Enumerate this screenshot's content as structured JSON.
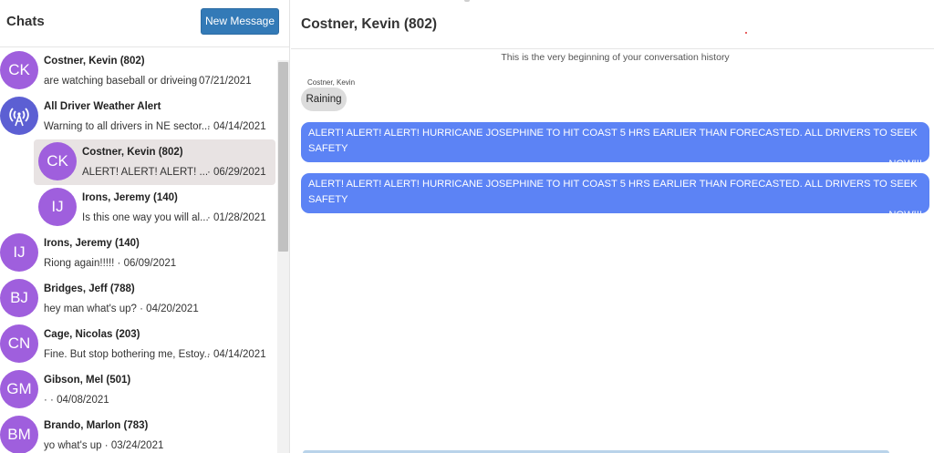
{
  "sidebar": {
    "title": "Chats",
    "new_message_label": "New Message",
    "chats": [
      {
        "initials": "CK",
        "name": "Costner, Kevin (802)",
        "preview": "are watching baseball or driveing",
        "date": "07/21/2021",
        "avatar_type": "initials"
      },
      {
        "initials": "",
        "name": "All Driver Weather Alert",
        "preview": "Warning to all drivers in NE sector...",
        "date": "04/14/2021",
        "avatar_type": "broadcast-icon"
      },
      {
        "initials": "CK",
        "name": "Costner, Kevin (802)",
        "preview": "ALERT! ALERT! ALERT! ...",
        "date": "06/29/2021",
        "avatar_type": "initials",
        "selected": true
      },
      {
        "initials": "IJ",
        "name": "Irons, Jeremy (140)",
        "preview": "Is this one way you will al...",
        "date": "01/28/2021",
        "avatar_type": "initials"
      },
      {
        "initials": "IJ",
        "name": "Irons, Jeremy (140)",
        "preview": "Riong again!!!!!",
        "date": "06/09/2021",
        "avatar_type": "initials"
      },
      {
        "initials": "BJ",
        "name": "Bridges, Jeff (788)",
        "preview": "hey man what's up?",
        "date": "04/20/2021",
        "avatar_type": "initials"
      },
      {
        "initials": "CN",
        "name": "Cage, Nicolas (203)",
        "preview": "Fine. But stop bothering me, Estoy...",
        "date": "04/14/2021",
        "avatar_type": "initials"
      },
      {
        "initials": "GM",
        "name": "Gibson, Mel (501)",
        "preview": "·",
        "date": "04/08/2021",
        "avatar_type": "initials"
      },
      {
        "initials": "BM",
        "name": "Brando, Marlon (783)",
        "preview": "yo what's up",
        "date": "03/24/2021",
        "avatar_type": "initials"
      }
    ]
  },
  "conversation": {
    "title": "Costner, Kevin (802)",
    "history_note": "This is the very beginning of your conversation history",
    "messages": [
      {
        "type": "received",
        "sender": "Costner, Kevin",
        "text": "Raining"
      },
      {
        "type": "sent",
        "line1": "ALERT! ALERT! ALERT! HURRICANE JOSEPHINE TO HIT COAST 5 HRS EARLIER THAN FORECASTED. ALL DRIVERS TO SEEK SAFETY",
        "line2": "NOW!!!"
      },
      {
        "type": "sent",
        "line1": "ALERT! ALERT! ALERT! HURRICANE JOSEPHINE TO HIT COAST 5 HRS EARLIER THAN FORECASTED. ALL DRIVERS TO SEEK SAFETY",
        "line2": "NOW!!!"
      }
    ]
  },
  "colors": {
    "avatar": "#9f5fdd",
    "broadcast_avatar": "#5c5fd3",
    "sent_bubble": "#5c83f5",
    "received_bubble": "#dcdcdc",
    "button": "#337ab7",
    "selected_row": "#e8e3e3"
  }
}
